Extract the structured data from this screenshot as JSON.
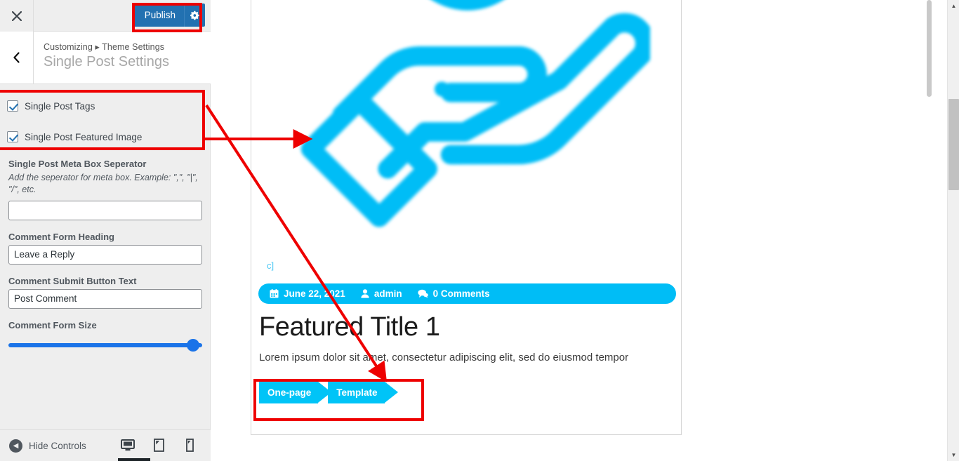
{
  "customizer": {
    "close_icon": "close-icon",
    "publish_label": "Publish",
    "publish_gear_icon": "gear-icon",
    "back_icon": "chevron-left-icon",
    "breadcrumb": "Customizing ▸ Theme Settings",
    "panel_title": "Single Post Settings",
    "checkboxes": [
      {
        "label": "Single Post Tags",
        "checked": true
      },
      {
        "label": "Single Post Featured Image",
        "checked": true
      }
    ],
    "fields": [
      {
        "label": "Single Post Meta Box Seperator",
        "description": "Add the seperator for meta box. Example: \",\", \"|\", \"/\", etc.",
        "value": ""
      },
      {
        "label": "Comment Form Heading",
        "value": "Leave a Reply"
      },
      {
        "label": "Comment Submit Button Text",
        "value": "Post Comment"
      }
    ],
    "slider": {
      "label": "Comment Form Size",
      "value_percent": 96
    },
    "footer": {
      "hide_controls_label": "Hide Controls",
      "hide_controls_icon": "chevron-left-circle-icon",
      "devices": [
        {
          "name": "desktop-preview",
          "icon": "desktop-icon",
          "active": true
        },
        {
          "name": "tablet-preview",
          "icon": "tablet-icon",
          "active": false
        },
        {
          "name": "mobile-preview",
          "icon": "mobile-icon",
          "active": false
        }
      ]
    }
  },
  "preview": {
    "featured_image_alt": "hand-holding-icon",
    "category": "c]",
    "meta": {
      "date": "June 22, 2021",
      "date_icon": "calendar-icon",
      "author": "admin",
      "author_icon": "user-icon",
      "comments": "0 Comments",
      "comments_icon": "comments-icon"
    },
    "title": "Featured Title 1",
    "excerpt": "Lorem ipsum dolor sit amet, consectetur adipiscing elit, sed do eiusmod tempor",
    "tags": [
      "One-page",
      "Template"
    ]
  },
  "colors": {
    "wp_blue": "#2271b1",
    "accent_cyan": "#00bdf6",
    "tag_cyan": "#00c4f7",
    "annotation_red": "#ee0000",
    "slider_blue": "#1a73e8"
  }
}
